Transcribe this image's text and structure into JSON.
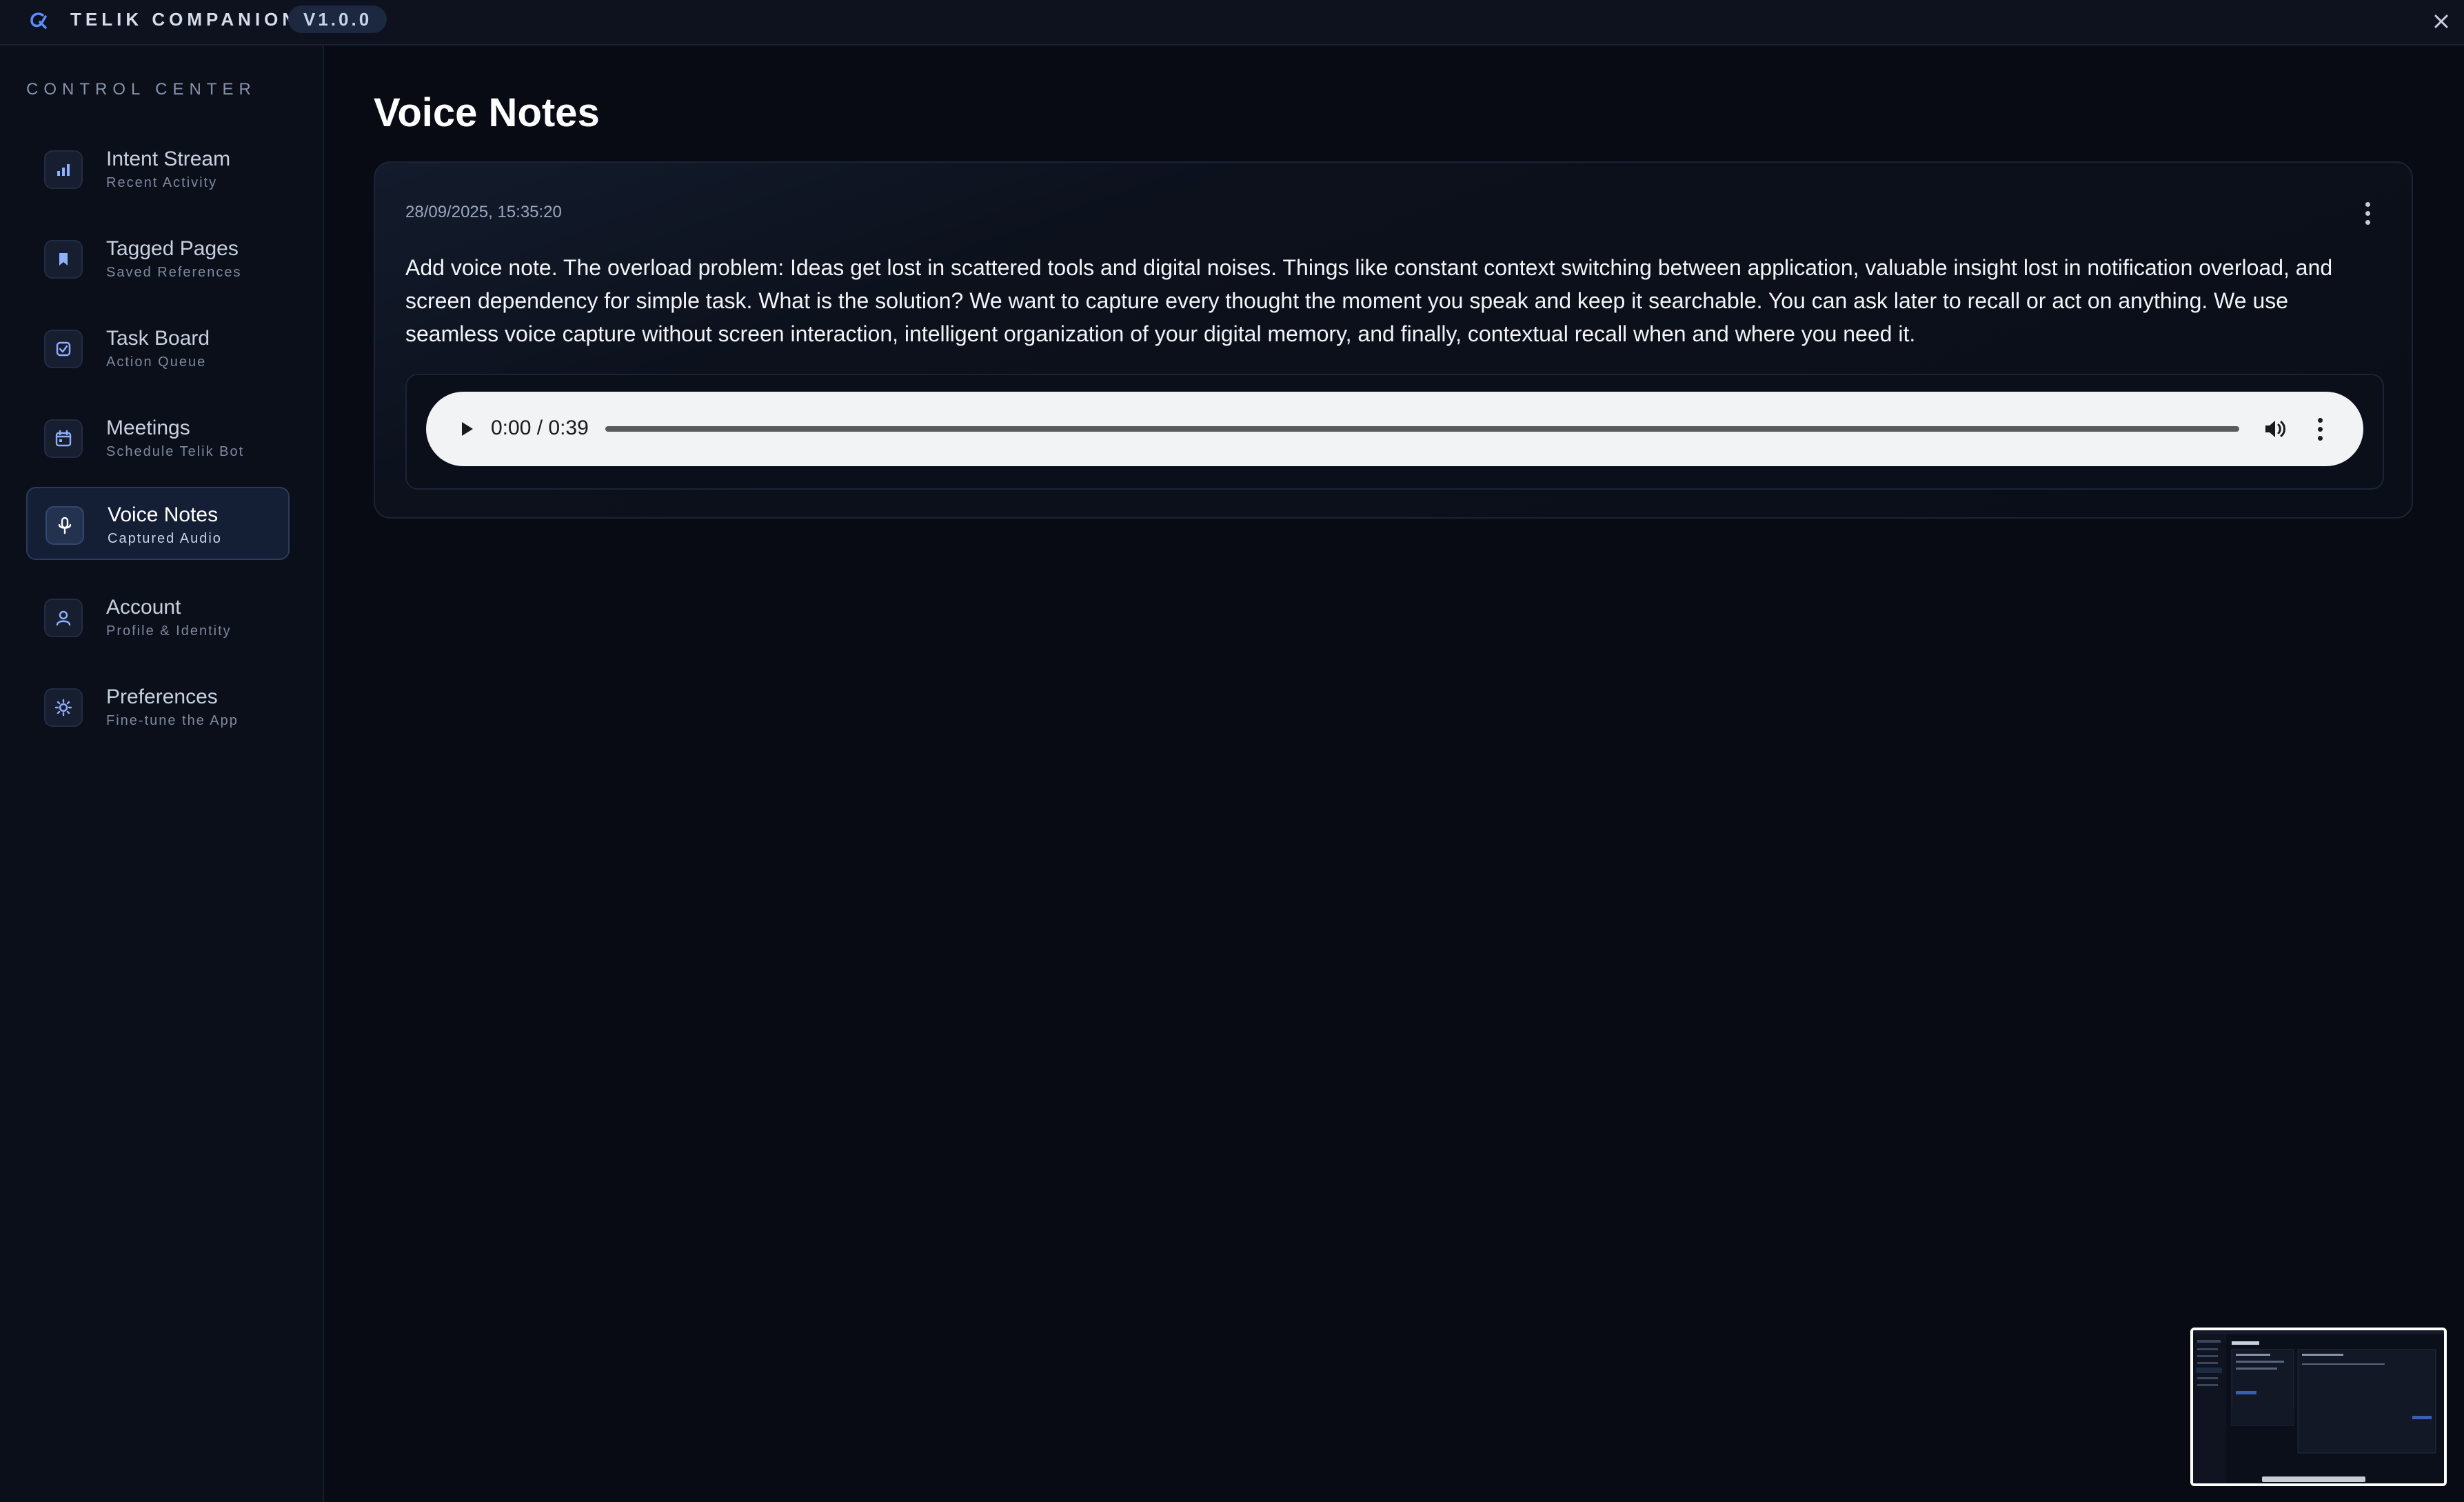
{
  "app": {
    "name": "TELIK COMPANION",
    "version": "V1.0.0"
  },
  "sidebar": {
    "section_label": "CONTROL CENTER",
    "items": [
      {
        "title": "Intent Stream",
        "subtitle": "Recent Activity",
        "icon": "bar-chart-icon",
        "active": false
      },
      {
        "title": "Tagged Pages",
        "subtitle": "Saved References",
        "icon": "bookmark-icon",
        "active": false
      },
      {
        "title": "Task Board",
        "subtitle": "Action Queue",
        "icon": "checkbox-icon",
        "active": false
      },
      {
        "title": "Meetings",
        "subtitle": "Schedule Telik Bot",
        "icon": "calendar-icon",
        "active": false
      },
      {
        "title": "Voice Notes",
        "subtitle": "Captured Audio",
        "icon": "microphone-icon",
        "active": true
      },
      {
        "title": "Account",
        "subtitle": "Profile & Identity",
        "icon": "user-icon",
        "active": false
      },
      {
        "title": "Preferences",
        "subtitle": "Fine-tune the App",
        "icon": "sun-icon",
        "active": false
      }
    ]
  },
  "main": {
    "title": "Voice Notes",
    "notes": [
      {
        "date": "28/09/2025, 15:35:20",
        "text": "Add voice note. The overload problem: Ideas get lost in scattered tools and digital noises. Things like constant context switching between application, valuable insight lost in notification overload, and screen dependency for simple task. What is the solution? We want to capture every thought the moment you speak and keep it searchable. You can ask later to recall or act on anything. We use seamless voice capture without screen interaction, intelligent organization of your digital memory, and finally, contextual recall when and where you need it.",
        "audio": {
          "time": "0:00 / 0:39",
          "progress": 0
        }
      }
    ]
  },
  "colors": {
    "background": "#080b14",
    "accent": "#5b8cff",
    "active_item": "#141f35"
  }
}
